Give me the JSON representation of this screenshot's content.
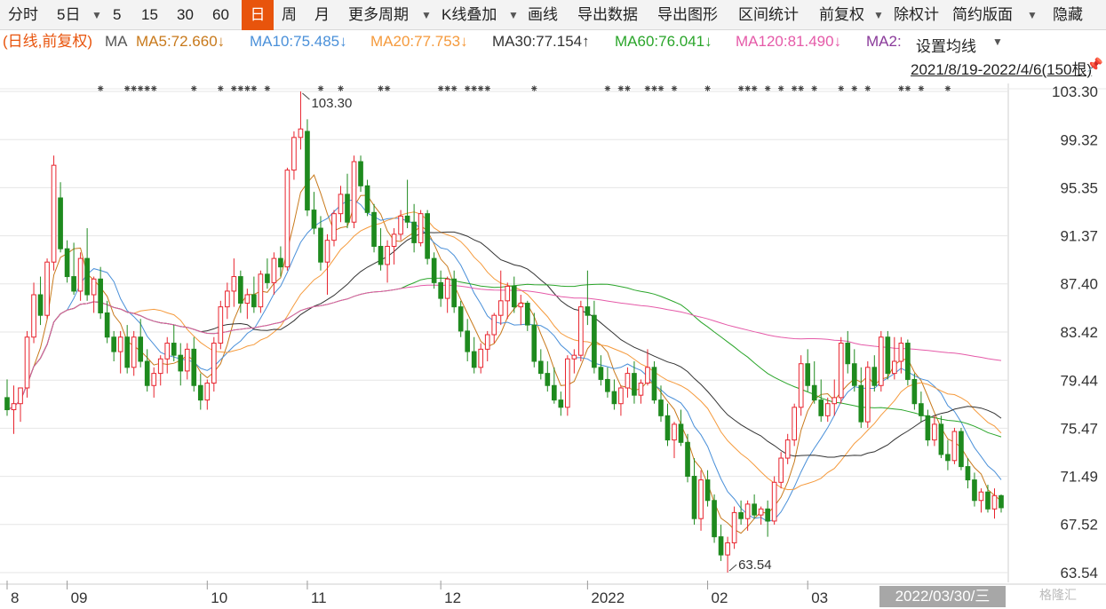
{
  "toolbar": {
    "items": [
      {
        "label": "分时"
      },
      {
        "label": "5日"
      },
      {
        "label": "5"
      },
      {
        "label": "15"
      },
      {
        "label": "30"
      },
      {
        "label": "60"
      },
      {
        "label": "日"
      },
      {
        "label": "周"
      },
      {
        "label": "月"
      },
      {
        "label": "更多周期"
      },
      {
        "label": "K线叠加"
      },
      {
        "label": "画线"
      },
      {
        "label": "导出数据"
      },
      {
        "label": "导出图形"
      },
      {
        "label": "区间统计"
      },
      {
        "label": "前复权"
      },
      {
        "label": "除权计"
      },
      {
        "label": "简约版面"
      },
      {
        "label": "隐藏"
      }
    ],
    "active": "日"
  },
  "ma_legend": {
    "prefix": "(日线,前复权)",
    "ma": "MA",
    "items": [
      {
        "label": "MA5:72.660↓",
        "color": "#c8791b"
      },
      {
        "label": "MA10:75.485↓",
        "color": "#4a90d9"
      },
      {
        "label": "MA20:77.753↓",
        "color": "#f59a3c"
      },
      {
        "label": "MA30:77.154↑",
        "color": "#333333"
      },
      {
        "label": "MA60:76.041↓",
        "color": "#2aa52a"
      },
      {
        "label": "MA120:81.490↓",
        "color": "#e55aa8"
      },
      {
        "label": "MA2:",
        "color": "#8a3a9a"
      }
    ]
  },
  "settings": {
    "label": "设置均线",
    "range": "2021/8/19-2022/4/6(150根)"
  },
  "cursor_date": "2022/03/30/三",
  "watermark": "格隆汇",
  "colors": {
    "up": "#e8242e",
    "down": "#1e8a1e",
    "grid": "#e6e6e6"
  },
  "chart_data": {
    "type": "candlestick",
    "y_ticks": [
      103.3,
      99.32,
      95.35,
      91.37,
      87.4,
      83.42,
      79.44,
      75.47,
      71.49,
      67.52,
      63.54
    ],
    "x_ticks": [
      {
        "label": "8",
        "index": 0
      },
      {
        "label": "09",
        "index": 9
      },
      {
        "label": "10",
        "index": 30
      },
      {
        "label": "11",
        "index": 45
      },
      {
        "label": "12",
        "index": 65
      },
      {
        "label": "2022",
        "index": 87
      },
      {
        "label": "02",
        "index": 105
      },
      {
        "label": "03",
        "index": 120
      }
    ],
    "annotations": [
      {
        "label": "103.30",
        "index": 44,
        "value": 103.3
      },
      {
        "label": "63.54",
        "index": 108,
        "value": 63.54
      }
    ],
    "ohlc": [
      [
        78.0,
        79.5,
        76.5,
        77.0
      ],
      [
        77.0,
        79.0,
        75.0,
        77.5
      ],
      [
        77.5,
        78.5,
        76.0,
        78.8
      ],
      [
        78.8,
        83.5,
        78.0,
        83.0
      ],
      [
        83.0,
        87.5,
        82.5,
        86.5
      ],
      [
        86.5,
        88.0,
        84.0,
        84.8
      ],
      [
        84.8,
        89.5,
        84.5,
        89.2
      ],
      [
        89.2,
        98.0,
        88.5,
        97.2
      ],
      [
        94.5,
        95.8,
        90.0,
        90.3
      ],
      [
        90.3,
        91.0,
        87.5,
        88.0
      ],
      [
        88.0,
        90.8,
        86.5,
        86.8
      ],
      [
        86.8,
        90.0,
        86.0,
        89.5
      ],
      [
        89.5,
        92.0,
        86.0,
        86.5
      ],
      [
        86.5,
        88.0,
        85.0,
        87.8
      ],
      [
        87.8,
        88.8,
        84.5,
        85.0
      ],
      [
        85.0,
        86.0,
        82.5,
        83.0
      ],
      [
        83.0,
        83.5,
        81.0,
        81.8
      ],
      [
        81.8,
        83.5,
        80.0,
        83.0
      ],
      [
        83.0,
        84.0,
        80.0,
        80.5
      ],
      [
        80.5,
        83.5,
        79.8,
        83.0
      ],
      [
        83.0,
        84.5,
        80.5,
        81.0
      ],
      [
        81.0,
        82.0,
        78.5,
        79.0
      ],
      [
        79.0,
        80.5,
        78.0,
        80.0
      ],
      [
        80.0,
        81.5,
        79.0,
        81.2
      ],
      [
        81.2,
        83.0,
        80.0,
        82.5
      ],
      [
        82.5,
        84.0,
        81.0,
        81.5
      ],
      [
        81.5,
        82.5,
        79.0,
        80.2
      ],
      [
        80.2,
        82.5,
        79.5,
        82.0
      ],
      [
        82.0,
        83.0,
        78.5,
        79.0
      ],
      [
        79.0,
        80.0,
        77.0,
        77.8
      ],
      [
        77.8,
        79.5,
        77.0,
        79.2
      ],
      [
        79.2,
        83.0,
        78.5,
        82.5
      ],
      [
        82.5,
        86.0,
        82.0,
        85.5
      ],
      [
        85.5,
        87.5,
        84.5,
        86.8
      ],
      [
        86.8,
        89.5,
        85.5,
        88.0
      ],
      [
        88.0,
        88.5,
        85.0,
        85.8
      ],
      [
        85.8,
        87.0,
        84.5,
        86.5
      ],
      [
        86.5,
        88.0,
        85.0,
        85.5
      ],
      [
        85.5,
        88.5,
        85.0,
        88.2
      ],
      [
        88.2,
        89.5,
        87.0,
        87.5
      ],
      [
        87.5,
        90.0,
        86.5,
        89.5
      ],
      [
        89.5,
        90.5,
        88.0,
        88.8
      ],
      [
        88.8,
        97.0,
        88.5,
        96.8
      ],
      [
        96.8,
        100.0,
        96.0,
        99.5
      ],
      [
        99.5,
        103.3,
        98.5,
        100.2
      ],
      [
        100.0,
        101.0,
        93.0,
        93.5
      ],
      [
        93.5,
        95.0,
        91.5,
        92.0
      ],
      [
        92.0,
        93.0,
        88.5,
        89.2
      ],
      [
        89.2,
        91.5,
        86.5,
        91.0
      ],
      [
        91.0,
        93.5,
        90.5,
        93.2
      ],
      [
        93.2,
        95.5,
        92.5,
        94.8
      ],
      [
        94.8,
        96.5,
        92.0,
        92.5
      ],
      [
        92.5,
        98.0,
        92.0,
        97.5
      ],
      [
        97.5,
        98.0,
        95.0,
        95.5
      ],
      [
        95.5,
        96.0,
        93.0,
        93.3
      ],
      [
        93.3,
        94.0,
        90.0,
        90.5
      ],
      [
        90.5,
        92.0,
        88.5,
        89.0
      ],
      [
        89.0,
        91.0,
        87.5,
        90.5
      ],
      [
        90.5,
        92.0,
        89.0,
        91.5
      ],
      [
        91.5,
        93.5,
        91.0,
        93.0
      ],
      [
        93.0,
        96.0,
        92.0,
        92.5
      ],
      [
        92.5,
        94.0,
        90.0,
        90.8
      ],
      [
        90.8,
        93.5,
        90.5,
        93.2
      ],
      [
        93.2,
        93.5,
        89.0,
        89.5
      ],
      [
        89.5,
        90.0,
        87.0,
        87.5
      ],
      [
        87.5,
        88.5,
        85.5,
        86.2
      ],
      [
        86.2,
        88.0,
        85.0,
        87.8
      ],
      [
        87.8,
        88.5,
        85.0,
        85.5
      ],
      [
        85.5,
        86.0,
        83.0,
        83.5
      ],
      [
        83.5,
        84.5,
        81.0,
        81.8
      ],
      [
        81.8,
        83.0,
        80.0,
        80.5
      ],
      [
        80.5,
        82.5,
        80.0,
        82.0
      ],
      [
        82.0,
        83.5,
        81.0,
        83.2
      ],
      [
        83.2,
        85.0,
        82.5,
        84.8
      ],
      [
        84.8,
        88.5,
        84.0,
        86.0
      ],
      [
        86.0,
        87.5,
        84.5,
        87.2
      ],
      [
        87.2,
        88.0,
        85.0,
        85.5
      ],
      [
        85.5,
        86.5,
        84.0,
        85.8
      ],
      [
        85.8,
        86.0,
        83.5,
        84.0
      ],
      [
        84.0,
        85.0,
        80.5,
        81.0
      ],
      [
        81.0,
        82.0,
        79.5,
        80.0
      ],
      [
        80.0,
        81.0,
        78.5,
        79.0
      ],
      [
        79.0,
        80.5,
        77.5,
        77.8
      ],
      [
        77.8,
        78.5,
        76.5,
        77.2
      ],
      [
        77.2,
        81.5,
        76.5,
        81.2
      ],
      [
        81.2,
        82.0,
        80.0,
        81.5
      ],
      [
        81.5,
        86.0,
        81.0,
        85.5
      ],
      [
        85.5,
        88.5,
        84.0,
        84.8
      ],
      [
        84.8,
        86.0,
        80.0,
        80.5
      ],
      [
        80.5,
        81.5,
        79.0,
        79.5
      ],
      [
        79.5,
        80.5,
        78.0,
        78.5
      ],
      [
        78.5,
        79.5,
        77.0,
        77.5
      ],
      [
        77.5,
        79.0,
        76.5,
        78.8
      ],
      [
        78.8,
        80.5,
        78.0,
        80.0
      ],
      [
        80.0,
        81.0,
        77.5,
        78.2
      ],
      [
        78.2,
        79.5,
        77.5,
        79.2
      ],
      [
        79.2,
        82.0,
        79.0,
        80.5
      ],
      [
        80.5,
        81.0,
        77.5,
        77.8
      ],
      [
        77.8,
        79.0,
        76.0,
        76.5
      ],
      [
        76.5,
        77.5,
        74.0,
        74.5
      ],
      [
        74.5,
        76.0,
        73.0,
        75.8
      ],
      [
        75.8,
        77.0,
        74.0,
        74.3
      ],
      [
        74.3,
        75.0,
        71.0,
        71.5
      ],
      [
        71.5,
        73.0,
        67.5,
        68.0
      ],
      [
        68.0,
        72.0,
        67.0,
        71.2
      ],
      [
        71.2,
        72.0,
        69.0,
        69.5
      ],
      [
        69.5,
        70.0,
        66.0,
        66.5
      ],
      [
        66.5,
        67.5,
        64.5,
        65.0
      ],
      [
        65.0,
        66.5,
        63.54,
        66.0
      ],
      [
        66.0,
        69.0,
        65.5,
        68.5
      ],
      [
        68.5,
        69.5,
        67.5,
        68.0
      ],
      [
        68.0,
        69.5,
        67.0,
        69.2
      ],
      [
        69.2,
        70.0,
        68.0,
        68.3
      ],
      [
        68.3,
        69.0,
        67.5,
        68.8
      ],
      [
        68.8,
        69.5,
        66.5,
        67.8
      ],
      [
        67.8,
        71.5,
        67.5,
        71.0
      ],
      [
        71.0,
        73.5,
        70.5,
        73.0
      ],
      [
        73.0,
        75.0,
        72.5,
        74.5
      ],
      [
        74.5,
        77.5,
        74.0,
        77.2
      ],
      [
        77.2,
        81.5,
        76.5,
        80.8
      ],
      [
        80.8,
        82.0,
        78.5,
        79.0
      ],
      [
        79.0,
        81.0,
        77.5,
        77.8
      ],
      [
        77.8,
        79.5,
        76.0,
        76.5
      ],
      [
        76.5,
        78.0,
        76.0,
        77.5
      ],
      [
        77.5,
        79.5,
        76.5,
        78.0
      ],
      [
        78.0,
        83.0,
        77.5,
        82.5
      ],
      [
        82.5,
        83.5,
        80.0,
        80.8
      ],
      [
        80.8,
        82.0,
        78.5,
        79.0
      ],
      [
        79.0,
        80.5,
        75.5,
        76.0
      ],
      [
        76.0,
        81.0,
        75.5,
        80.5
      ],
      [
        80.5,
        81.5,
        78.5,
        79.0
      ],
      [
        79.0,
        83.5,
        78.5,
        83.0
      ],
      [
        83.0,
        83.5,
        79.5,
        80.0
      ],
      [
        80.0,
        83.0,
        79.5,
        81.0
      ],
      [
        81.0,
        83.0,
        80.0,
        82.5
      ],
      [
        82.5,
        82.8,
        79.0,
        79.5
      ],
      [
        79.5,
        80.0,
        77.0,
        77.5
      ],
      [
        77.5,
        78.5,
        76.0,
        76.5
      ],
      [
        76.5,
        77.0,
        74.0,
        74.5
      ],
      [
        74.5,
        76.5,
        74.0,
        75.8
      ],
      [
        75.8,
        76.5,
        73.0,
        73.3
      ],
      [
        73.3,
        74.5,
        72.0,
        72.8
      ],
      [
        72.8,
        75.5,
        72.5,
        75.2
      ],
      [
        75.2,
        75.5,
        72.0,
        72.3
      ],
      [
        72.3,
        73.0,
        70.5,
        71.2
      ],
      [
        71.2,
        71.8,
        69.0,
        69.5
      ],
      [
        69.5,
        70.5,
        68.5,
        70.2
      ],
      [
        70.2,
        70.8,
        68.5,
        68.8
      ],
      [
        68.8,
        70.5,
        68.0,
        69.9
      ],
      [
        69.9,
        70.0,
        68.5,
        68.9
      ]
    ]
  }
}
